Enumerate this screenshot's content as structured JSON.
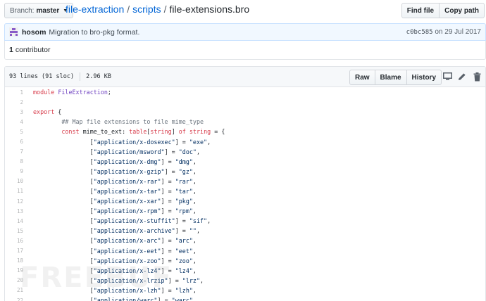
{
  "topbar": {
    "branch_label": "Branch:",
    "branch_value": "master",
    "breadcrumb": {
      "repo": "file-extraction",
      "folder": "scripts",
      "file": "file-extensions.bro"
    },
    "find_file_label": "Find file",
    "copy_path_label": "Copy path"
  },
  "commit": {
    "author": "hosom",
    "message": "Migration to bro-pkg format.",
    "sha": "c0bc585",
    "date_text": "on 29 Jul 2017"
  },
  "contributors": {
    "count": "1",
    "label": "contributor"
  },
  "file": {
    "lines_info": "93 lines (91 sloc)",
    "size": "2.96 KB",
    "raw_label": "Raw",
    "blame_label": "Blame",
    "history_label": "History",
    "desktop_icon": "desktop-icon",
    "edit_icon": "pencil-icon",
    "delete_icon": "trash-icon"
  },
  "code_lines": [
    {
      "n": "1",
      "text": "module FileExtraction;"
    },
    {
      "n": "2",
      "text": ""
    },
    {
      "n": "3",
      "text": "export {"
    },
    {
      "n": "4",
      "text": "        ## Map file extensions to file mime_type"
    },
    {
      "n": "5",
      "text": "        const mime_to_ext: table[string] of string = {"
    },
    {
      "n": "6",
      "text": "                [\"application/x-dosexec\"] = \"exe\","
    },
    {
      "n": "7",
      "text": "                [\"application/msword\"] = \"doc\","
    },
    {
      "n": "8",
      "text": "                [\"application/x-dmg\"] = \"dmg\","
    },
    {
      "n": "9",
      "text": "                [\"application/x-gzip\"] = \"gz\","
    },
    {
      "n": "10",
      "text": "                [\"application/x-rar\"] = \"rar\","
    },
    {
      "n": "11",
      "text": "                [\"application/x-tar\"] = \"tar\","
    },
    {
      "n": "12",
      "text": "                [\"application/x-xar\"] = \"pkg\","
    },
    {
      "n": "13",
      "text": "                [\"application/x-rpm\"] = \"rpm\","
    },
    {
      "n": "14",
      "text": "                [\"application/x-stuffit\"] = \"sif\","
    },
    {
      "n": "15",
      "text": "                [\"application/x-archive\"] = \"\","
    },
    {
      "n": "16",
      "text": "                [\"application/x-arc\"] = \"arc\","
    },
    {
      "n": "17",
      "text": "                [\"application/x-eet\"] = \"eet\","
    },
    {
      "n": "18",
      "text": "                [\"application/x-zoo\"] = \"zoo\","
    },
    {
      "n": "19",
      "text": "                [\"application/x-lz4\"] = \"lz4\","
    },
    {
      "n": "20",
      "text": "                [\"application/x-lrzip\"] = \"lrz\","
    },
    {
      "n": "21",
      "text": "                [\"application/x-lzh\"] = \"lzh\","
    },
    {
      "n": "22",
      "text": "                [\"application/warc\"] = \"warc\","
    }
  ],
  "watermark": "FREEBUF"
}
